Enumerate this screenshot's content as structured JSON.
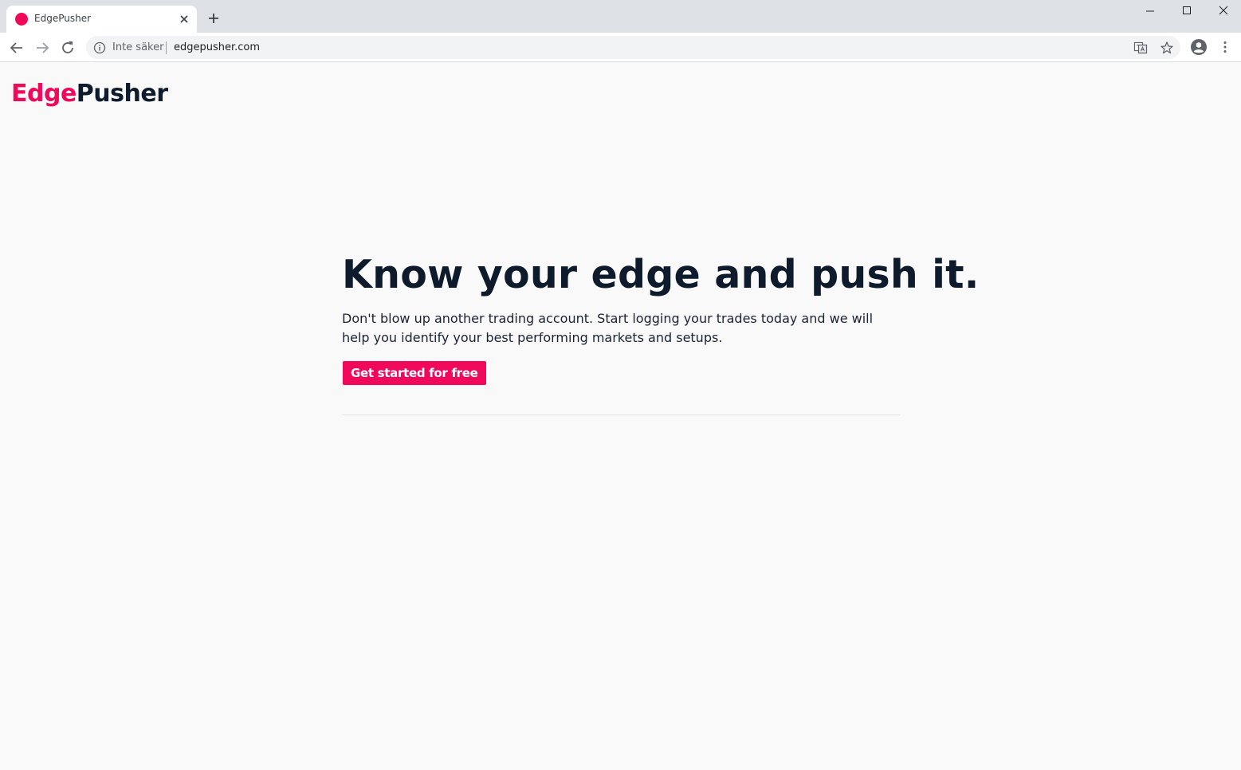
{
  "browser": {
    "tab": {
      "title": "EdgePusher",
      "favicon_color": "#f0085a"
    },
    "omnibox": {
      "security_label": "Inte säker",
      "url": "edgepusher.com"
    }
  },
  "page": {
    "logo": {
      "part1": "Edge",
      "part2": "Pusher"
    },
    "hero": {
      "headline": "Know your edge and push it.",
      "description": "Don't blow up another trading account. Start logging your trades today and we will help you identify your best performing markets and setups.",
      "cta_label": "Get started for free"
    }
  },
  "colors": {
    "accent": "#f0085a",
    "dark": "#0e1b2d"
  },
  "icons": [
    "close-icon",
    "plus-icon",
    "minimize-icon",
    "maximize-icon",
    "back-icon",
    "forward-icon",
    "reload-icon",
    "info-icon",
    "translate-icon",
    "star-icon",
    "account-icon",
    "menu-icon"
  ]
}
